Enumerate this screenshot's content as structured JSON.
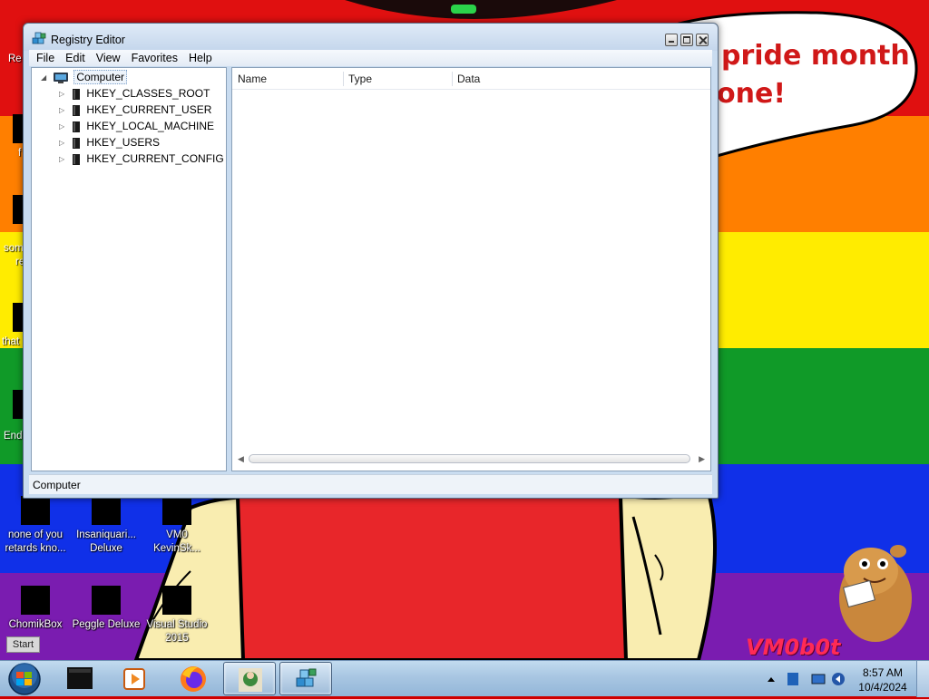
{
  "wallpaper": {
    "bubble_lines": [
      "pride month",
      "one!"
    ],
    "watermark": "VM0b0t"
  },
  "desktop": {
    "icons": [
      {
        "label": "none of you retards kno..."
      },
      {
        "label": "Insaniquari... Deluxe"
      },
      {
        "label": "VM0 KevinSk..."
      },
      {
        "label": "ChomikBox"
      },
      {
        "label": "Peggle Deluxe"
      },
      {
        "label": "Visual Studio 2015"
      }
    ],
    "edge_labels": [
      "Re",
      "f",
      "som",
      "re",
      "that",
      "End"
    ],
    "start_chip": "Start"
  },
  "window": {
    "title": "Registry Editor",
    "menu": [
      "File",
      "Edit",
      "View",
      "Favorites",
      "Help"
    ],
    "tree": {
      "root": "Computer",
      "hives": [
        "HKEY_CLASSES_ROOT",
        "HKEY_CURRENT_USER",
        "HKEY_LOCAL_MACHINE",
        "HKEY_USERS",
        "HKEY_CURRENT_CONFIG"
      ]
    },
    "columns": [
      "Name",
      "Type",
      "Data"
    ],
    "status": "Computer"
  },
  "taskbar": {
    "clock_time": "8:57 AM",
    "clock_date": "10/4/2024"
  }
}
